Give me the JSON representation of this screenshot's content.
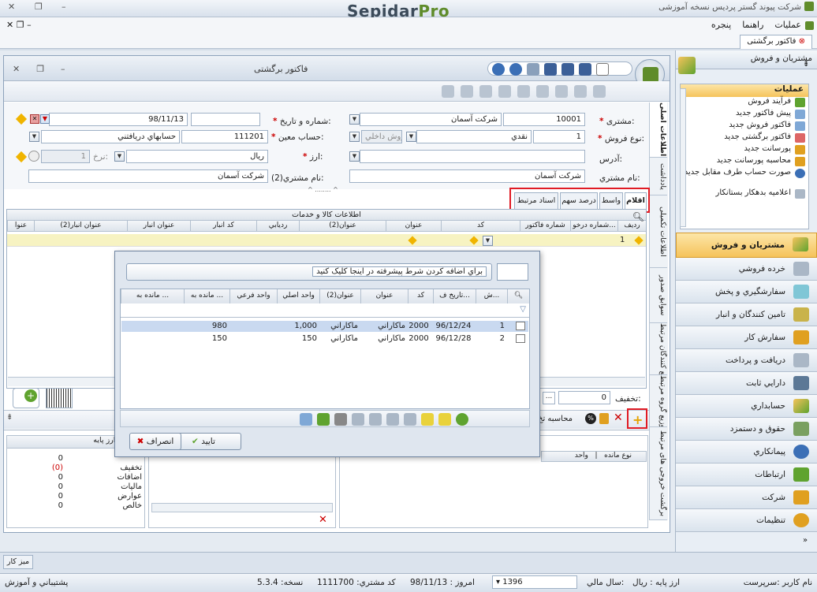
{
  "app": {
    "title": "شرکت پیوند گستر پردیس نسخه آموزشی",
    "brand_main": "Sepidar",
    "brand_pro": "Pro"
  },
  "menu": {
    "items": [
      "عملیات",
      "راهنما",
      "پنجره"
    ]
  },
  "doc_tab": "فاکتور برگشتی",
  "form": {
    "window_title": "فاکتور برگشتی",
    "customer_label": "مشتری:",
    "customer_code": "10001",
    "customer_name": "شرکت آسمان",
    "number_date_label": "شماره و تاریخ:",
    "date_value": "98/11/13",
    "sale_type_label": "نوع فروش:",
    "sale_type_code": "1",
    "sale_type_name": "نقدي",
    "sale_kind": "فروش داخلي",
    "account_label": "حساب معین:",
    "account_code": "111201",
    "account_name": "حسابهاي دريافتني",
    "address_label": "آدرس:",
    "currency_label": "ارز:",
    "currency_value": "ريال",
    "rate_label": "نرخ:",
    "rate_value": "1",
    "customer_name_label": "نام مشتري:",
    "customer_name_value": "شرکت آسمان",
    "customer2_label": "نام مشتري(2):",
    "customer2_value": "شرکت آسمان"
  },
  "vertical_tabs": [
    "اطلاعات اصلی",
    "یادداشت",
    "اطلاعات تکمیلی",
    "سوابق صدور",
    "توزیع کنندگان مرتبط",
    "توزیع گروه مرتبط",
    "برگشت خروجی های مرتبط"
  ],
  "htabs": [
    "اقلام",
    "واسط",
    "درصد سهم",
    "اسناد مرتبط"
  ],
  "grid": {
    "group_header": "اطلاعات کالا و خدمات",
    "columns": [
      "رديف",
      "شماره درخو...",
      "شماره فاکتور",
      "کد",
      "عنوان",
      "عنوان(2)",
      "رديابي",
      "کد انبار",
      "عنوان انبار",
      "عنوان انبار(2)",
      "عنوا"
    ],
    "row_number": "1"
  },
  "discount_label": "تخفیف:",
  "discount_value": "0",
  "dialog": {
    "filter_text": "براي اضافه کردن شرط پيشرفته در اينجا کليک کنيد",
    "columns": [
      "ش...",
      "تاريخ ف...",
      "کد",
      "عنوان",
      "عنوان(2)",
      "واحد اصلي",
      "واحد فرعي",
      "مانده به ...",
      "مانده به ..."
    ],
    "rows": [
      {
        "num": "1",
        "date": "96/12/24",
        "code": "2000",
        "title": "ماکاراني",
        "title2": "ماکاراني",
        "unit": "1,000",
        "remain": "980"
      },
      {
        "num": "2",
        "date": "96/12/28",
        "code": "2000",
        "title": "ماکاراني",
        "title2": "ماکاراني",
        "unit": "150",
        "remain": "150"
      }
    ],
    "ok_label": "تاييد",
    "cancel_label": "انصراف"
  },
  "calc_label": "محاسبه تخ",
  "summary": {
    "header": "مبالغ به ارز پایه",
    "rows": [
      {
        "label": "",
        "value": "0"
      },
      {
        "label": "تخفیف",
        "value": "(0)"
      },
      {
        "label": "اضافات",
        "value": "0"
      },
      {
        "label": "مالیات",
        "value": "0"
      },
      {
        "label": "عوارض",
        "value": "0"
      },
      {
        "label": "خالص",
        "value": "0"
      }
    ]
  },
  "bottom_grid": {
    "col1": "نوع مانده",
    "col2": "واحد"
  },
  "sidebar": {
    "header": "مشتریان و فروش",
    "ops_title": "عملیات",
    "ops": [
      "فرآیند فروش",
      "پیش فاکتور جدید",
      "فاکتور فروش جدید",
      "فاکتور برگشتی جدید",
      "پورسانت جدید",
      "محاسبه پورسانت جدید",
      "صورت حساب طرف مقابل جدید",
      "اعلامیه بدهکار بستانکار"
    ],
    "nav": [
      "مشتریان و فروش",
      "خرده فروشي",
      "سفارشگيري و پخش",
      "تامين کنندگان و انبار",
      "سفارش کار",
      "دريافت و پرداخت",
      "دارايي ثابت",
      "حسابداري",
      "حقوق و دستمزد",
      "پيمانکاري",
      "ارتباطات",
      "شرکت",
      "تنظيمات"
    ]
  },
  "taskbar": "ميز کار",
  "status": {
    "user": "نام کاربر :سرپرست",
    "base_currency": "ارز پايه :   ريال",
    "fiscal_year_label": "سال مالي:",
    "fiscal_year": "1396",
    "today": "امروز :   98/11/13",
    "customer_code": "کد مشتري:   1111700",
    "version": "نسخه:   5.3.4",
    "support": "پشتيباني و آموزش"
  },
  "colors": {
    "accent": "#f5c35b",
    "highlight": "#e01b24",
    "selection": "#c9d9f0"
  }
}
